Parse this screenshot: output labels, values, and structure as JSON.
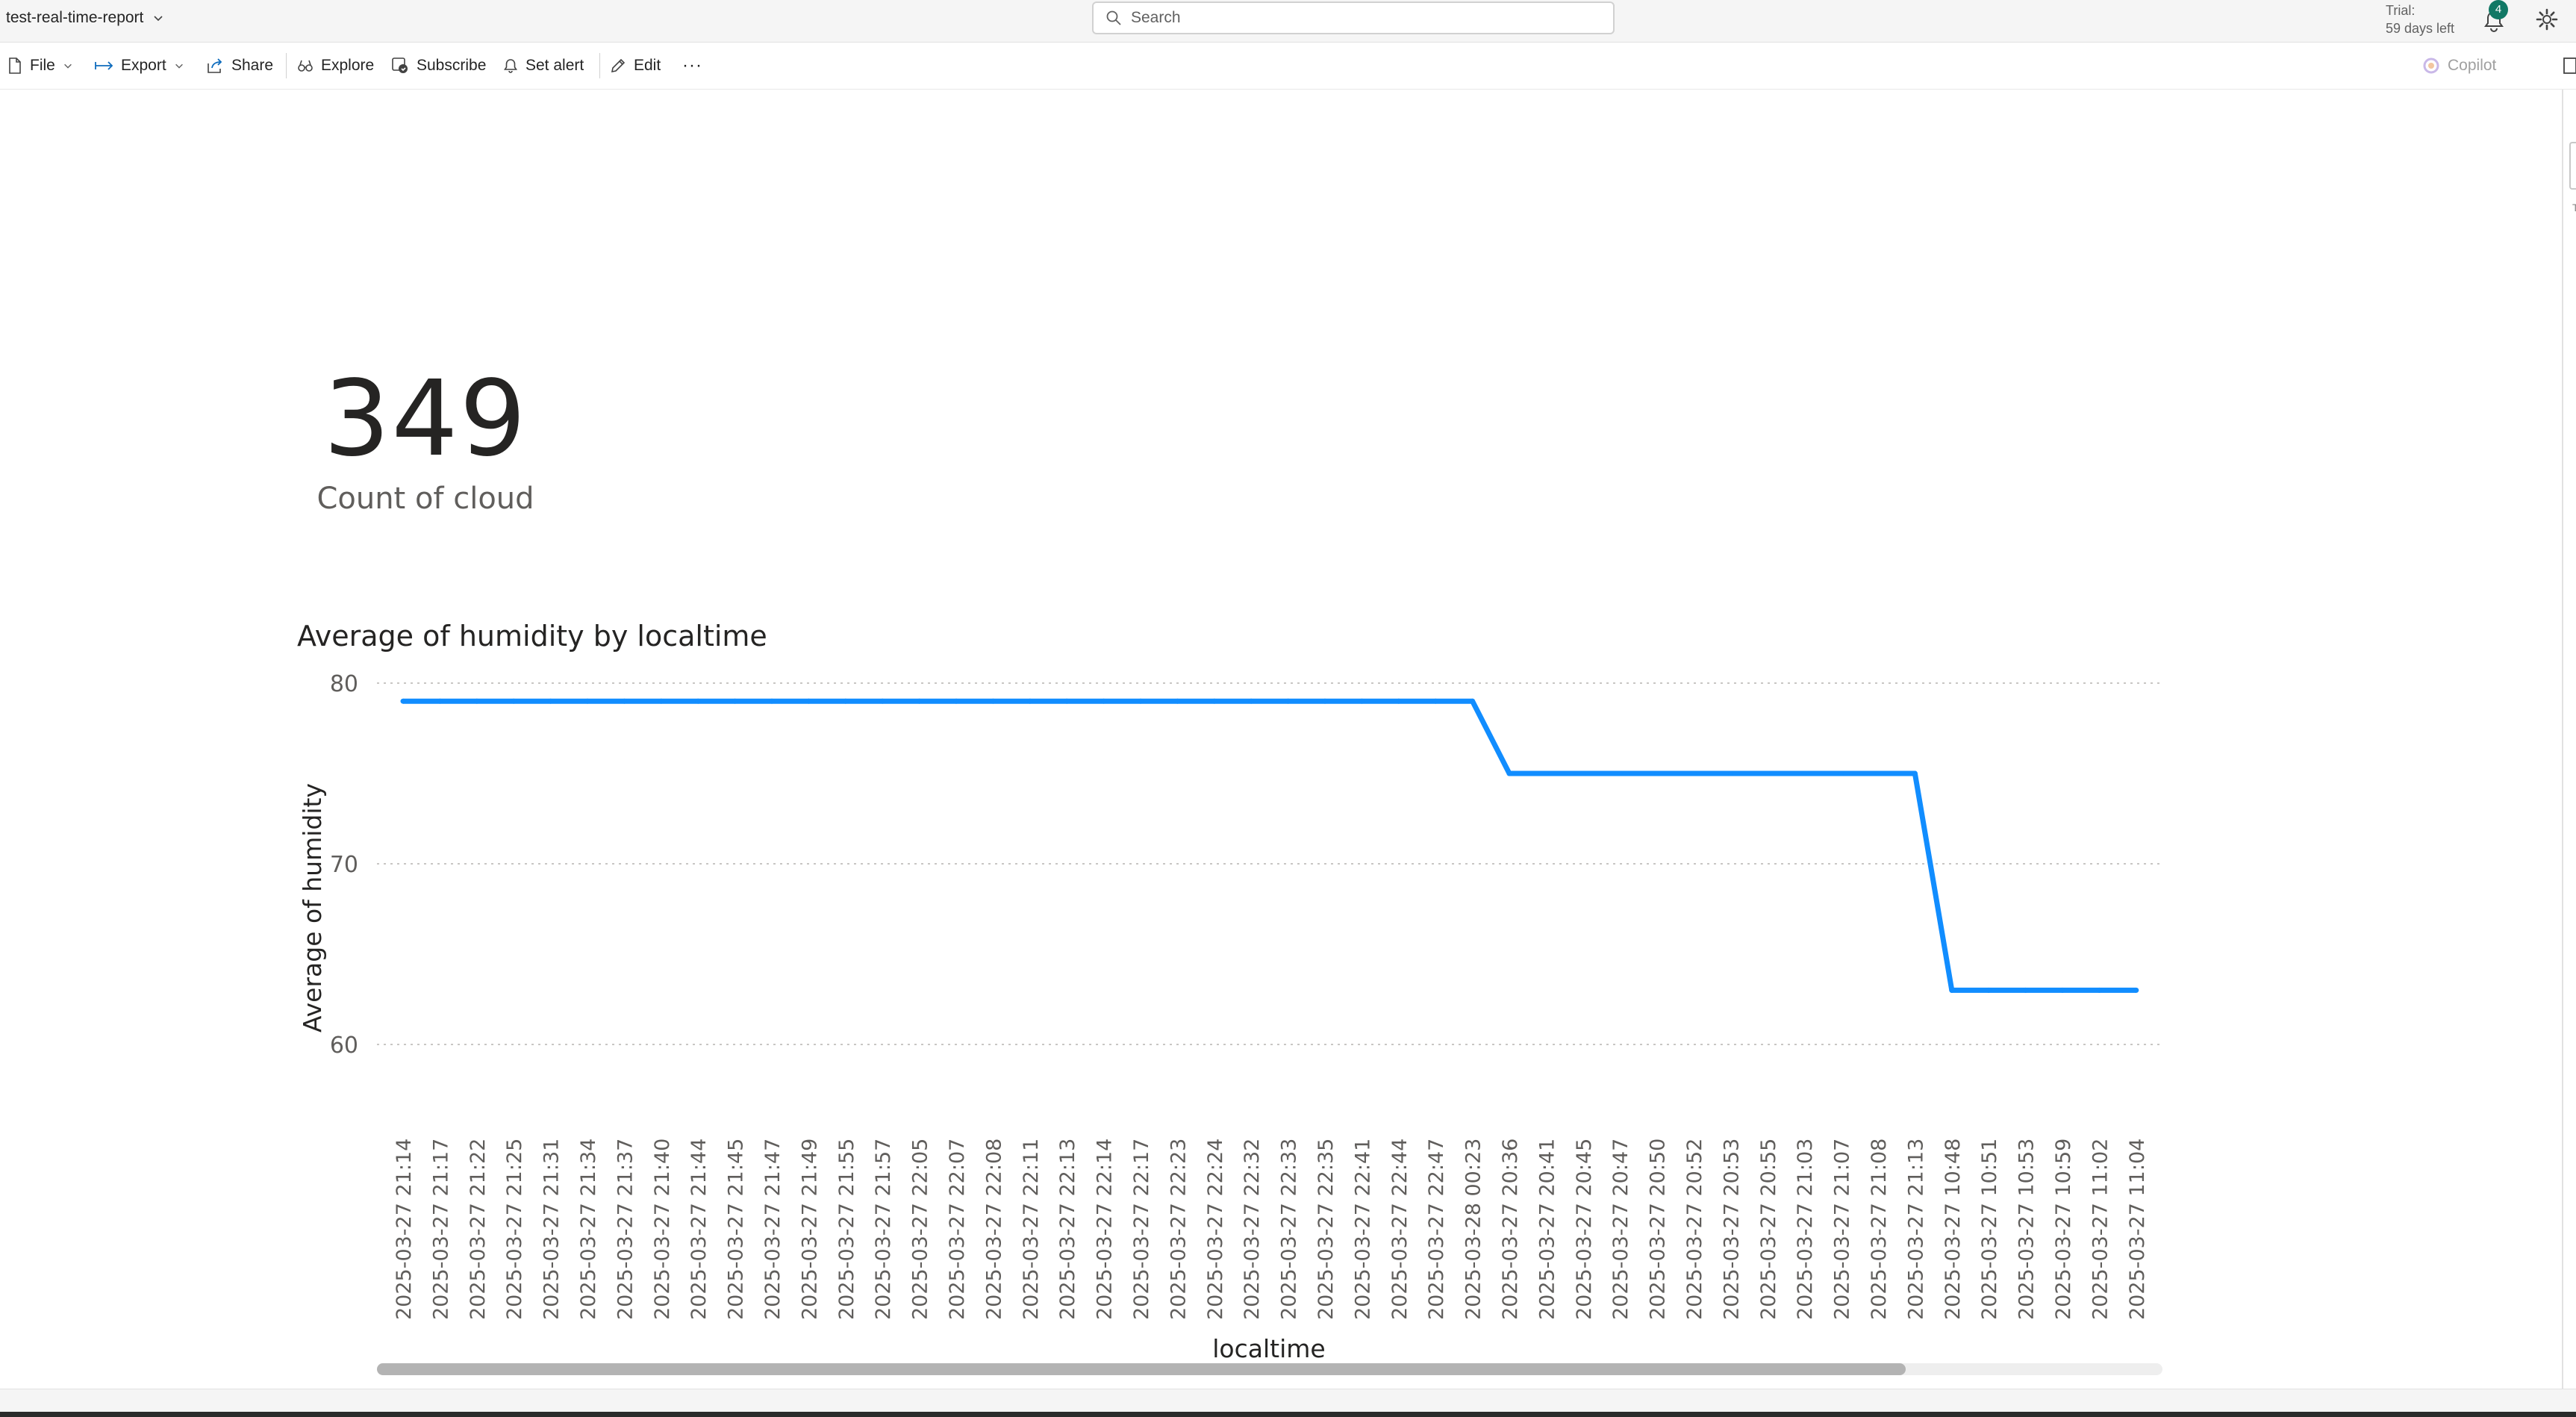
{
  "header": {
    "report_name": "test-real-time-report",
    "search_placeholder": "Search",
    "trial_line1": "Trial:",
    "trial_line2": "59 days left",
    "notification_count": "4"
  },
  "toolbar": {
    "file": "File",
    "export": "Export",
    "share": "Share",
    "explore": "Explore",
    "subscribe": "Subscribe",
    "set_alert": "Set alert",
    "edit": "Edit",
    "more": "···",
    "copilot": "Copilot"
  },
  "kpi": {
    "value": "349",
    "label": "Count of cloud"
  },
  "colors": {
    "line": "#118dff",
    "badge": "#117865"
  },
  "chart_data": {
    "type": "line",
    "title": "Average of humidity by localtime",
    "xlabel": "localtime",
    "ylabel": "Average of humidity",
    "ylim": [
      57,
      80
    ],
    "yticks": [
      80,
      70,
      60
    ],
    "grid": true,
    "categories": [
      "2025-03-27 21:14",
      "2025-03-27 21:17",
      "2025-03-27 21:22",
      "2025-03-27 21:25",
      "2025-03-27 21:31",
      "2025-03-27 21:34",
      "2025-03-27 21:37",
      "2025-03-27 21:40",
      "2025-03-27 21:44",
      "2025-03-27 21:45",
      "2025-03-27 21:47",
      "2025-03-27 21:49",
      "2025-03-27 21:55",
      "2025-03-27 21:57",
      "2025-03-27 22:05",
      "2025-03-27 22:07",
      "2025-03-27 22:08",
      "2025-03-27 22:11",
      "2025-03-27 22:13",
      "2025-03-27 22:14",
      "2025-03-27 22:17",
      "2025-03-27 22:23",
      "2025-03-27 22:24",
      "2025-03-27 22:32",
      "2025-03-27 22:33",
      "2025-03-27 22:35",
      "2025-03-27 22:41",
      "2025-03-27 22:44",
      "2025-03-27 22:47",
      "2025-03-28 00:23",
      "2025-03-27 20:36",
      "2025-03-27 20:41",
      "2025-03-27 20:45",
      "2025-03-27 20:47",
      "2025-03-27 20:50",
      "2025-03-27 20:52",
      "2025-03-27 20:53",
      "2025-03-27 20:55",
      "2025-03-27 21:03",
      "2025-03-27 21:07",
      "2025-03-27 21:08",
      "2025-03-27 21:13",
      "2025-03-27 10:48",
      "2025-03-27 10:51",
      "2025-03-27 10:53",
      "2025-03-27 10:59",
      "2025-03-27 11:02",
      "2025-03-27 11:04"
    ],
    "series": [
      {
        "values": [
          79,
          79,
          79,
          79,
          79,
          79,
          79,
          79,
          79,
          79,
          79,
          79,
          79,
          79,
          79,
          79,
          79,
          79,
          79,
          79,
          79,
          79,
          79,
          79,
          79,
          79,
          79,
          79,
          79,
          79,
          75,
          75,
          75,
          75,
          75,
          75,
          75,
          75,
          75,
          75,
          75,
          75,
          63,
          63,
          63,
          63,
          63,
          63
        ]
      }
    ]
  }
}
